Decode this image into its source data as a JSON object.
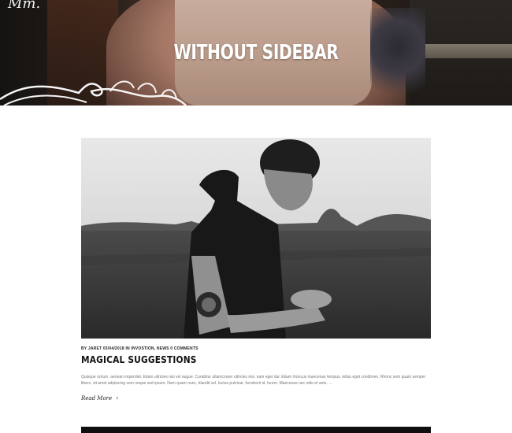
{
  "hero": {
    "brand": "Mm.",
    "title": "WITHOUT SIDEBAR"
  },
  "post": {
    "meta": "BY JARET 03/04/2018 IN INVOSTION, NEWS 0 COMMENTS",
    "title": "MAGICAL SUGGESTIONS",
    "excerpt": "Quisque rutrum, aenean imperdiet. Etiam ultricies nisi vel augue. Curabitur ullamcorper ultricies nisi, nam eget dui. Etiam rhoncus maecenas tempus, tellus eget condimen. Rhonc sem quam semper libero, sit amet adipiscing sem neque sed ipsum. Nam quam nunc, blandit vel, luctus pulvinar, hendrerit id, lorem. Maecenas nec odio et ante. ...",
    "read_more": "Read More",
    "read_more_icon": "chevron-right-icon"
  }
}
